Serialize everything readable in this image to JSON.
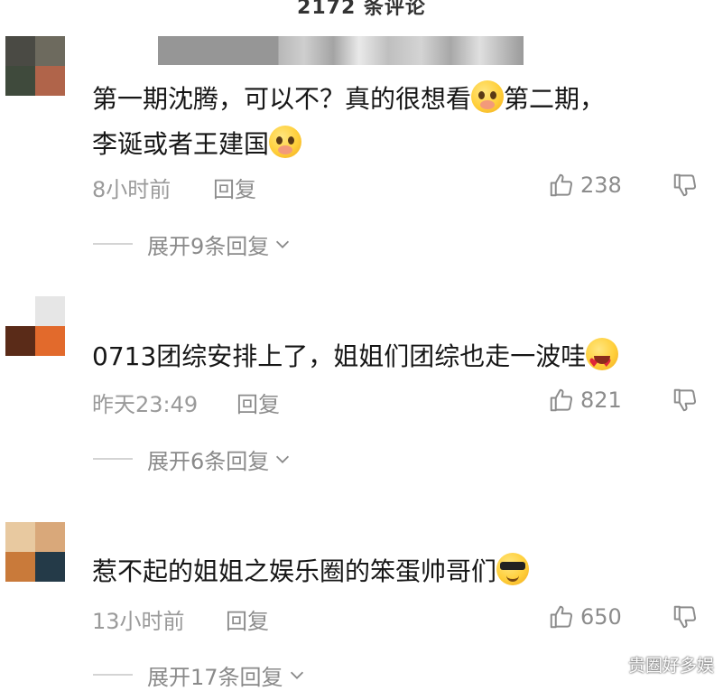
{
  "header": {
    "title": "2172 条评论"
  },
  "comments": [
    {
      "text_lines": [
        "第一期沈腾，可以不？真的很想看",
        "第二期，",
        "李诞或者王建国"
      ],
      "emojis": [
        "shy-face-emoji",
        "shy-face-emoji"
      ],
      "time": "8小时前",
      "reply_label": "回复",
      "likes": "238",
      "expand_label": "展开9条回复",
      "avatar_colors": [
        "#4a4a44",
        "#6d6a5e",
        "#3f4a3c",
        "#b0644a"
      ]
    },
    {
      "text_lines": [
        "0713团综安排上了，姐姐们团综也走一波哇"
      ],
      "emojis": [
        "heart-eyes-emoji"
      ],
      "time": "昨天23:49",
      "reply_label": "回复",
      "likes": "821",
      "expand_label": "展开6条回复",
      "avatar_colors": [
        "#ffffff",
        "#e6e6e6",
        "#5a2b18",
        "#e26a2c"
      ]
    },
    {
      "text_lines": [
        "惹不起的姐姐之娱乐圈的笨蛋帅哥们"
      ],
      "emojis": [
        "sunglasses-face-emoji"
      ],
      "time": "13小时前",
      "reply_label": "回复",
      "likes": "650",
      "expand_label": "展开17条回复",
      "avatar_colors": [
        "#e8c9a0",
        "#d9a87a",
        "#c97a3a",
        "#243a48"
      ]
    }
  ],
  "watermark": "贵圈好多娱"
}
